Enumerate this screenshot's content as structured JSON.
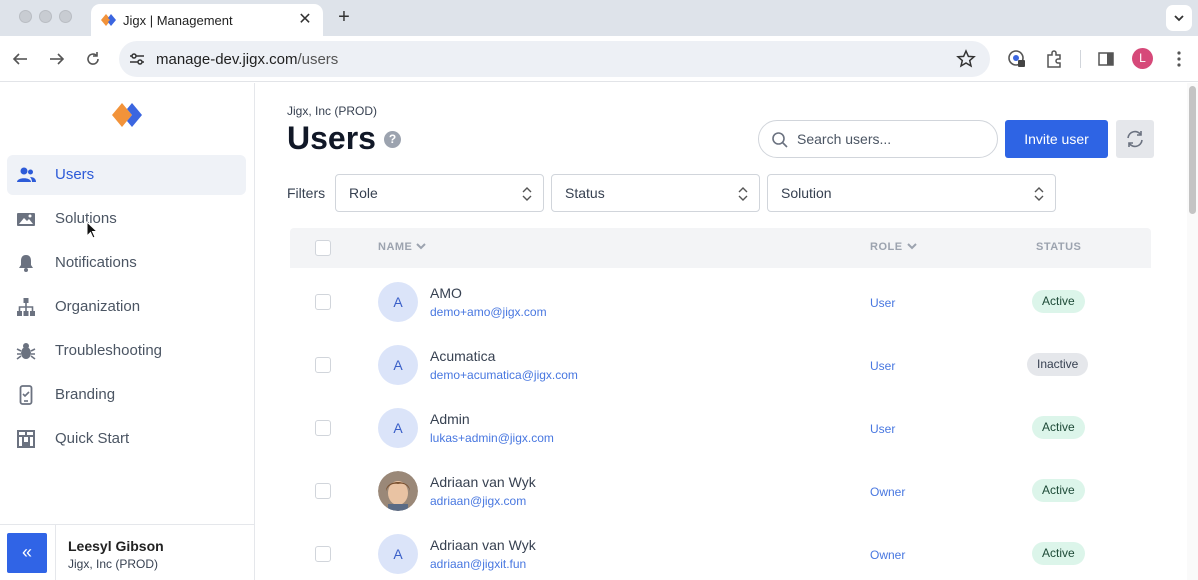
{
  "browser": {
    "tab_title": "Jigx | Management",
    "url_host": "manage-dev.jigx.com",
    "url_path": "/users",
    "profile_initial": "L"
  },
  "sidebar": {
    "items": [
      {
        "label": "Users",
        "icon": "users-icon",
        "active": true
      },
      {
        "label": "Solutions",
        "icon": "solutions-icon",
        "active": false
      },
      {
        "label": "Notifications",
        "icon": "bell-icon",
        "active": false
      },
      {
        "label": "Organization",
        "icon": "org-chart-icon",
        "active": false
      },
      {
        "label": "Troubleshooting",
        "icon": "bug-icon",
        "active": false
      },
      {
        "label": "Branding",
        "icon": "mobile-device-icon",
        "active": false
      },
      {
        "label": "Quick Start",
        "icon": "quick-start-icon",
        "active": false
      }
    ],
    "footer": {
      "user_name": "Leesyl Gibson",
      "org": "Jigx, Inc (PROD)"
    }
  },
  "header": {
    "org_label": "Jigx, Inc (PROD)",
    "title": "Users",
    "help": "?",
    "search_placeholder": "Search users...",
    "invite_label": "Invite user"
  },
  "filters": {
    "label": "Filters",
    "role": "Role",
    "status": "Status",
    "solution": "Solution"
  },
  "table": {
    "columns": {
      "name": "NAME",
      "role": "ROLE",
      "status": "STATUS"
    },
    "rows": [
      {
        "initial": "A",
        "name": "AMO",
        "email": "demo+amo@jigx.com",
        "role": "User",
        "status": "Active"
      },
      {
        "initial": "A",
        "name": "Acumatica",
        "email": "demo+acumatica@jigx.com",
        "role": "User",
        "status": "Inactive"
      },
      {
        "initial": "A",
        "name": "Admin",
        "email": "lukas+admin@jigx.com",
        "role": "User",
        "status": "Active"
      },
      {
        "initial": "",
        "name": "Adriaan van Wyk",
        "email": "adriaan@jigx.com",
        "role": "Owner",
        "status": "Active"
      },
      {
        "initial": "A",
        "name": "Adriaan van Wyk",
        "email": "adriaan@jigxit.fun",
        "role": "Owner",
        "status": "Active"
      }
    ]
  },
  "colors": {
    "primary": "#2e64e4",
    "link": "#4877e0",
    "active_badge_bg": "#dcf5ea",
    "inactive_badge_bg": "#e5e7eb",
    "logo_orange": "#f2933a",
    "logo_blue": "#3b66e0"
  }
}
